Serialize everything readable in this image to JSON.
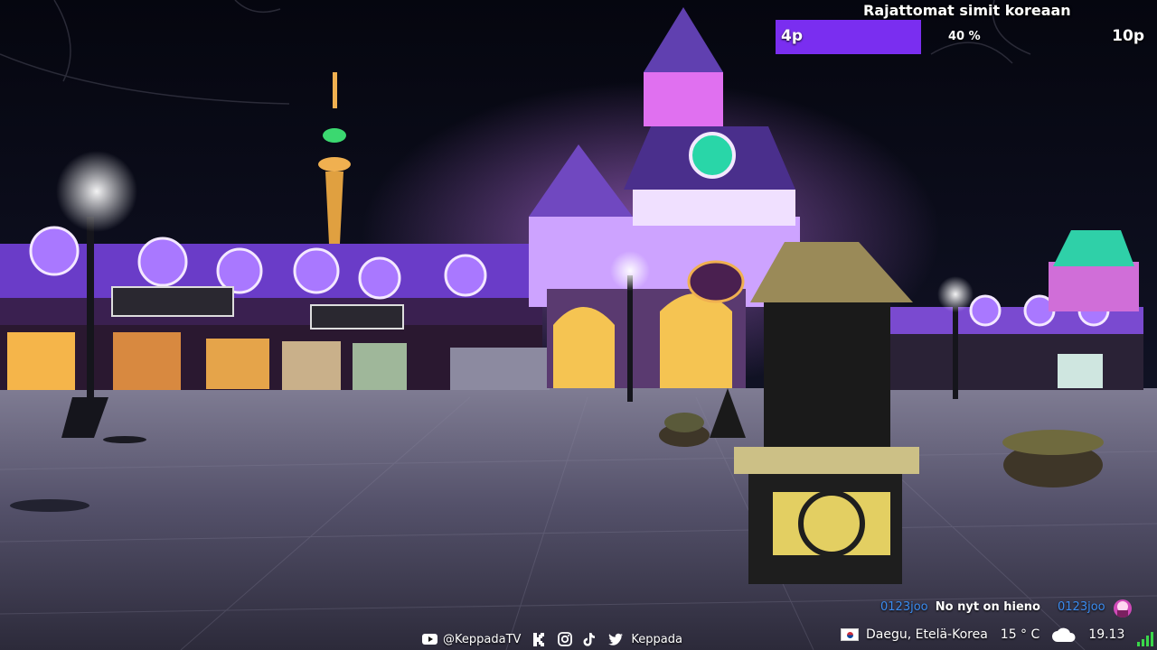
{
  "goal": {
    "title": "Rajattomat simit koreaan",
    "start_label": "4p",
    "percent_label": "40 %",
    "progress": 0.4,
    "end_label": "10p",
    "fill_color": "#7a2ef0"
  },
  "chat": {
    "user": "0123joo",
    "message": "No nyt on hieno",
    "user2": "0123joo",
    "user_color": "#3b8cf0"
  },
  "socials": {
    "youtube_handle": "@KeppadaTV",
    "handle": "Keppada",
    "icons": [
      "youtube-icon",
      "kick-icon",
      "instagram-icon",
      "tiktok-icon",
      "twitter-icon"
    ]
  },
  "status": {
    "location": "Daegu, Etelä-Korea",
    "temperature": "15 ° C",
    "weather_icon": "cloud-icon",
    "time": "19.13",
    "flag": "south-korea-flag"
  }
}
